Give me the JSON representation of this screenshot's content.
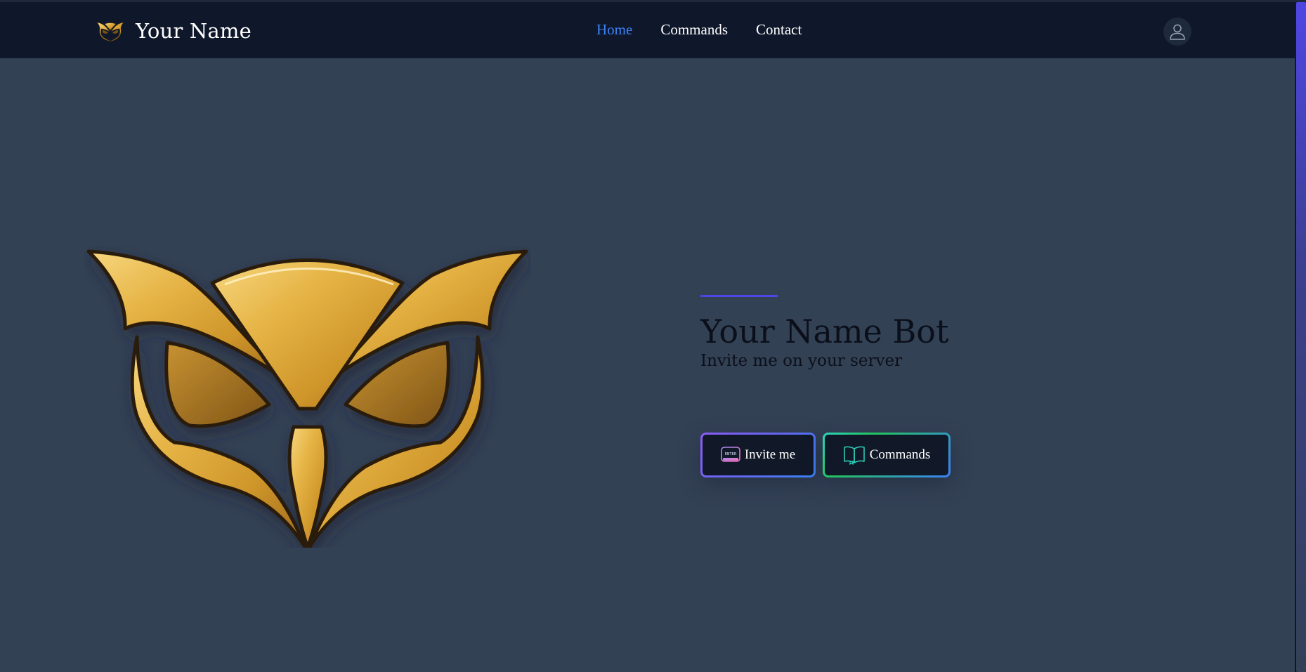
{
  "navbar": {
    "brand_name": "Your Name",
    "links": [
      {
        "label": "Home",
        "active": true
      },
      {
        "label": "Commands",
        "active": false
      },
      {
        "label": "Contact",
        "active": false
      }
    ],
    "user_icon": "user-icon"
  },
  "hero": {
    "title": "Your Name Bot",
    "subtitle": "Invite me on your server",
    "image": "golden-owl-logo"
  },
  "buttons": {
    "invite_label": "Invite me",
    "invite_icon": "enter-key-icon",
    "enter_key_text": "ENTER",
    "commands_label": "Commands",
    "commands_icon": "book-icon"
  },
  "colors": {
    "page_bg": "#334155",
    "navbar_bg": "#0f172a",
    "active_link": "#3b82f6",
    "accent_line": "#4f46e5",
    "owl_gold": "#d9a233"
  }
}
